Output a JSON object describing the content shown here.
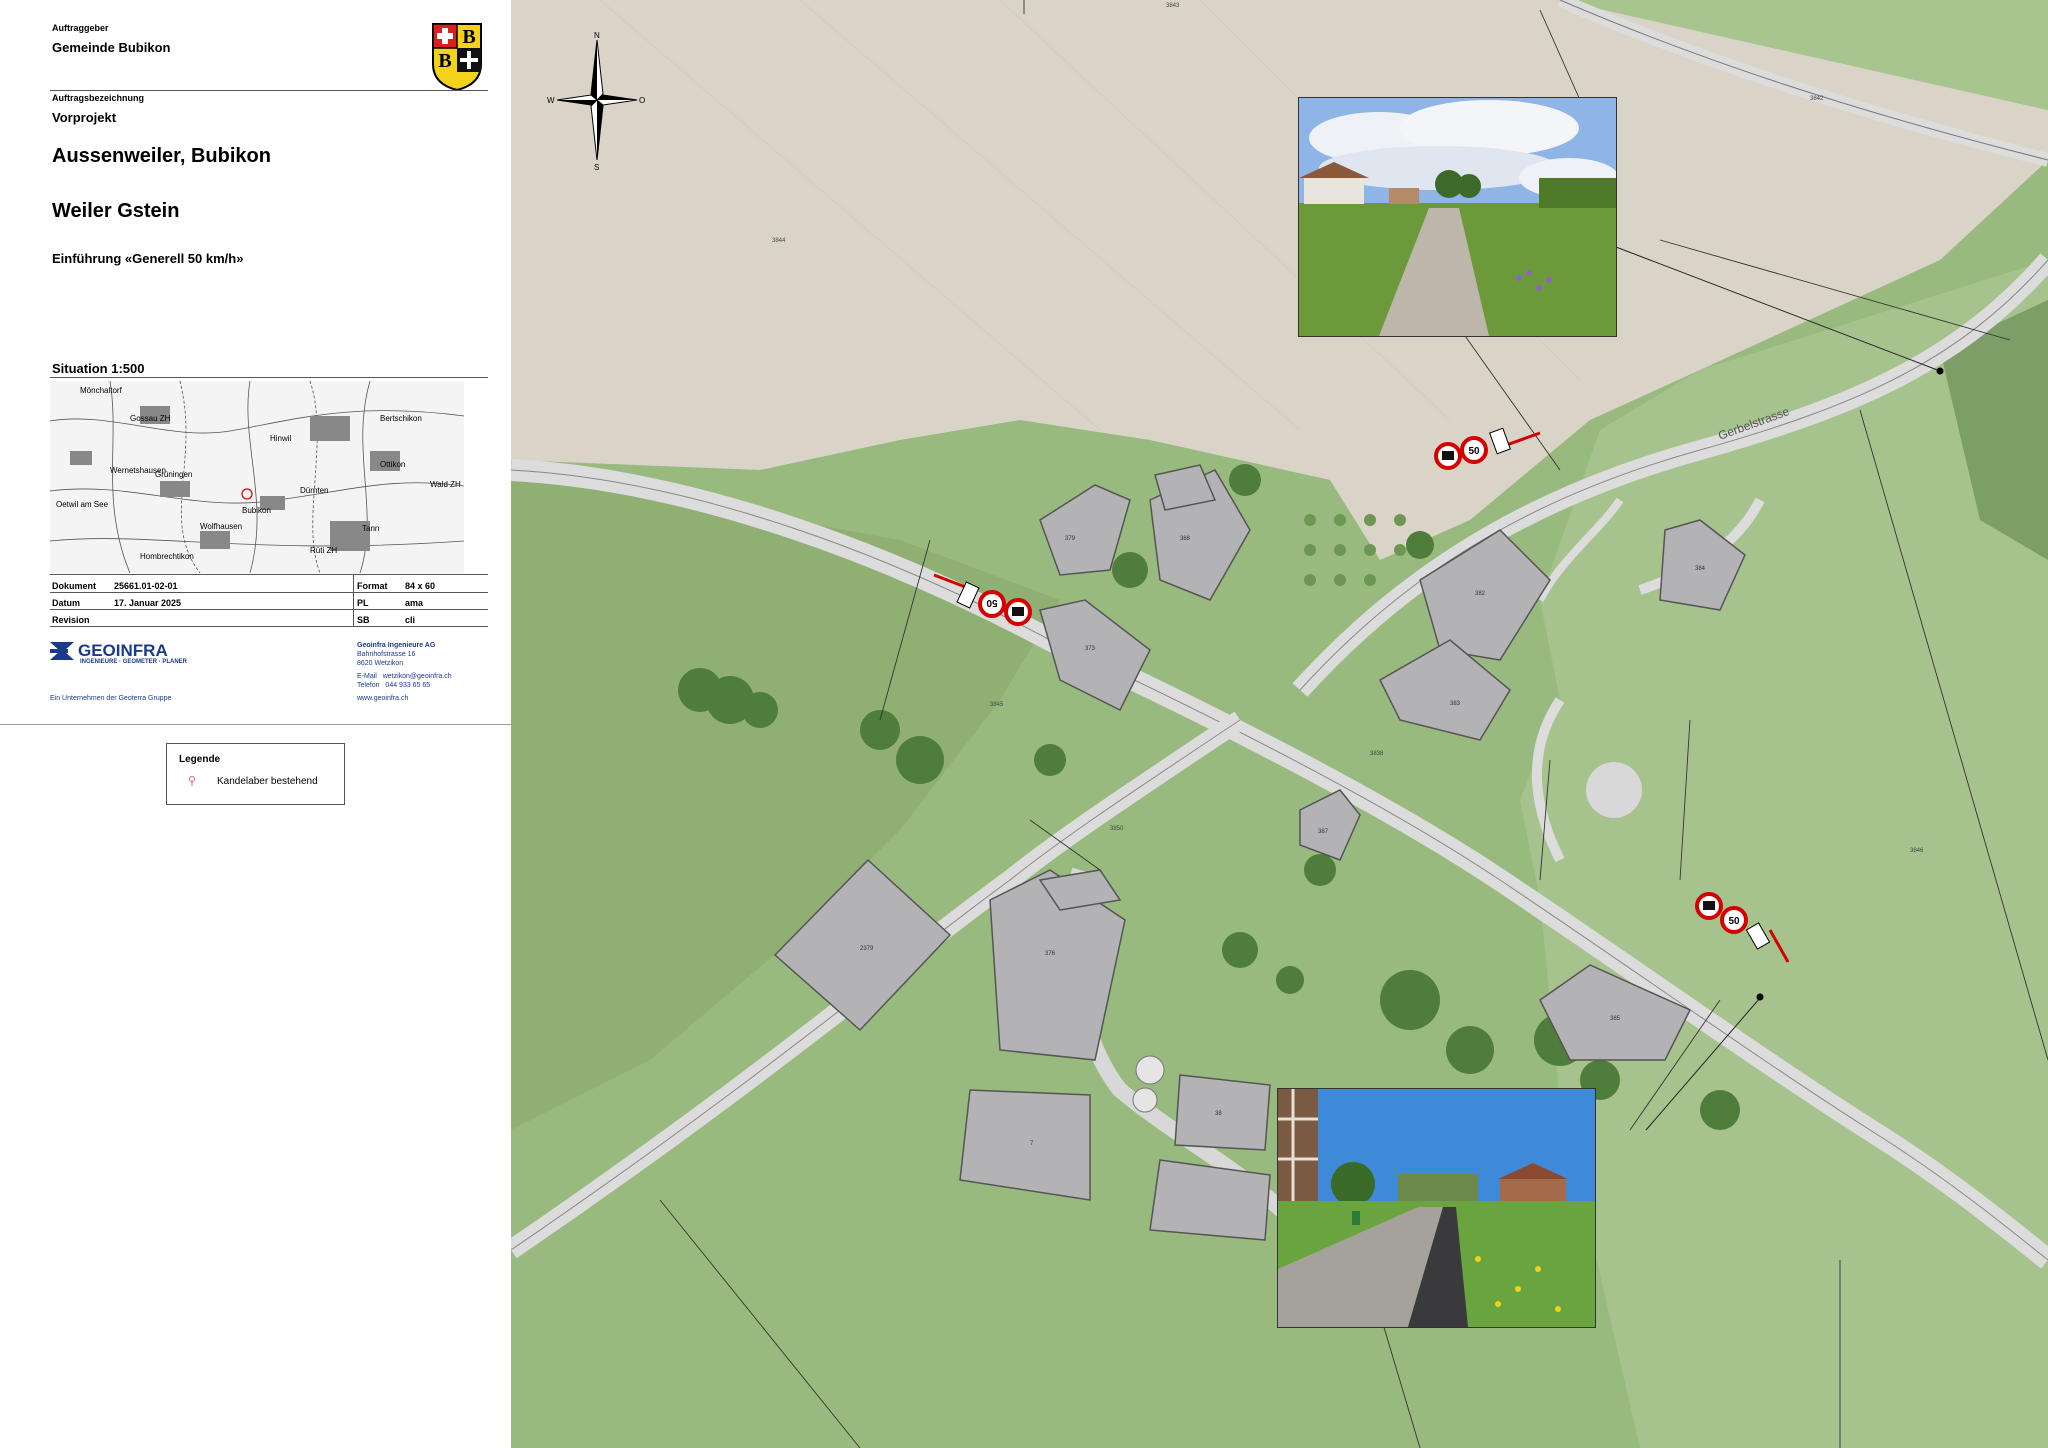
{
  "title_block": {
    "client_label": "Auftraggeber",
    "client_name": "Gemeinde Bubikon",
    "order_label": "Auftragsbezeichnung",
    "order_type": "Vorprojekt",
    "project_title": "Aussenweiler, Bubikon",
    "project_subtitle": "Weiler Gstein",
    "project_description": "Einführung «Generell 50 km/h»",
    "situation_label": "Situation 1:500"
  },
  "overview_map": {
    "place_names": [
      "Mönchaltorf",
      "Gossau ZH",
      "Hinwil",
      "Grüningen",
      "Dürnten",
      "Wald ZH",
      "Oetwil am See",
      "Bubikon",
      "Wolfhausen",
      "Hombrechtikon",
      "Rüti ZH",
      "Tann",
      "Ottikon",
      "Wernetshausen",
      "Bertschikon"
    ]
  },
  "document_info": {
    "rows": [
      {
        "label": "Dokument",
        "value": "25661.01-02-01",
        "label2": "Format",
        "value2": "84 x 60"
      },
      {
        "label": "Datum",
        "value": "17. Januar 2025",
        "label2": "PL",
        "value2": "ama"
      },
      {
        "label": "Revision",
        "value": "",
        "label2": "SB",
        "value2": "cli"
      }
    ]
  },
  "company": {
    "logo_name": "GEOINFRA",
    "logo_tagline": "INGENIEURE · GEOMETER · PLANER",
    "group_note": "Ein Unternehmen der Geoterra Gruppe",
    "name": "Geoinfra Ingenieure AG",
    "street": "Bahnhofstrasse 16",
    "city": "8620 Wetzikon",
    "email_label": "E-Mail",
    "email": "wetzikon@geoinfra.ch",
    "phone_label": "Telefon",
    "phone": "044 933 65 65",
    "website": "www.geoinfra.ch"
  },
  "legend": {
    "title": "Legende",
    "items": [
      {
        "label": "Kandelaber bestehend"
      }
    ]
  },
  "map": {
    "street_name": "Gerbelstrasse",
    "compass": {
      "n": "N",
      "s": "S",
      "w": "W",
      "e": "O"
    },
    "parcel_numbers": [
      "3843",
      "3842",
      "3844",
      "3846",
      "3838",
      "3850",
      "3845"
    ],
    "speed_sign_value": "50",
    "colors": {
      "field_brown": "#d9d2c6",
      "meadow_green": "#93b57a",
      "road": "#d8d8d8",
      "building": "#b3b3b6",
      "sign_red": "#d50000",
      "blue_line": "#1a2a9a"
    }
  },
  "crest": {
    "letters": [
      "B",
      "B"
    ]
  }
}
